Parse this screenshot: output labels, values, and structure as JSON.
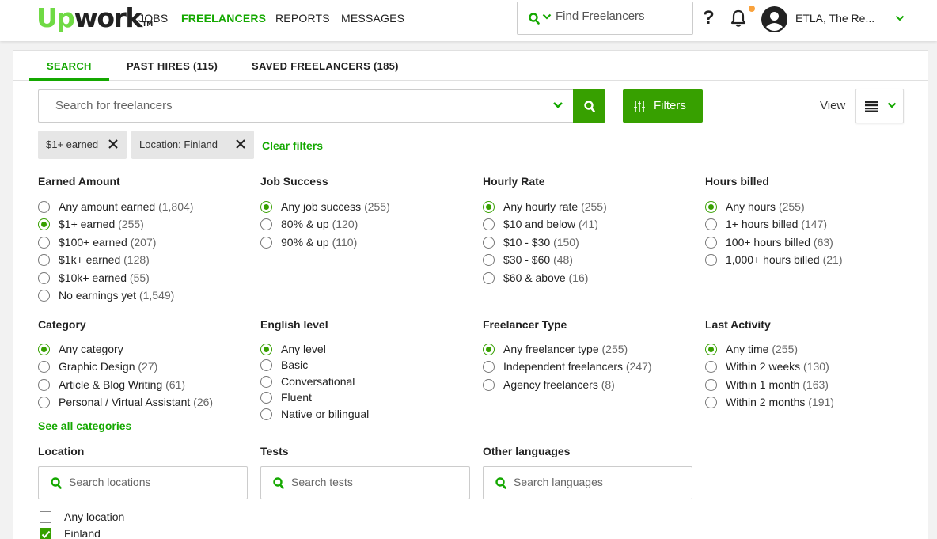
{
  "nav": {
    "logo_up": "Up",
    "logo_work": "work",
    "logo_tm": "TM",
    "links": [
      "JOBS",
      "FREELANCERS",
      "REPORTS",
      "MESSAGES"
    ],
    "active_link": "FREELANCERS",
    "search_placeholder": "Find Freelancers",
    "help": "?",
    "account_name": "ETLA, The Re..."
  },
  "tabs": [
    "SEARCH",
    "PAST HIRES (115)",
    "SAVED FREELANCERS (185)"
  ],
  "search": {
    "placeholder": "Search for freelancers",
    "filters_label": "Filters",
    "view_label": "View"
  },
  "chips": [
    "$1+ earned",
    "Location: Finland"
  ],
  "clear_filters": "Clear filters",
  "sections": {
    "earned": {
      "title": "Earned Amount",
      "options": [
        {
          "label": "Any amount earned",
          "count": "(1,804)",
          "selected": false
        },
        {
          "label": "$1+ earned",
          "count": "(255)",
          "selected": true
        },
        {
          "label": "$100+ earned",
          "count": "(207)",
          "selected": false
        },
        {
          "label": "$1k+ earned",
          "count": "(128)",
          "selected": false
        },
        {
          "label": "$10k+ earned",
          "count": "(55)",
          "selected": false
        },
        {
          "label": "No earnings yet",
          "count": "(1,549)",
          "selected": false
        }
      ]
    },
    "job_success": {
      "title": "Job Success",
      "options": [
        {
          "label": "Any job success",
          "count": "(255)",
          "selected": true
        },
        {
          "label": "80% & up",
          "count": "(120)",
          "selected": false
        },
        {
          "label": "90% & up",
          "count": "(110)",
          "selected": false
        }
      ]
    },
    "hourly_rate": {
      "title": "Hourly Rate",
      "options": [
        {
          "label": "Any hourly rate",
          "count": "(255)",
          "selected": true
        },
        {
          "label": "$10 and below",
          "count": "(41)",
          "selected": false
        },
        {
          "label": "$10 - $30",
          "count": "(150)",
          "selected": false
        },
        {
          "label": "$30 - $60",
          "count": "(48)",
          "selected": false
        },
        {
          "label": "$60 & above",
          "count": "(16)",
          "selected": false
        }
      ]
    },
    "hours_billed": {
      "title": "Hours billed",
      "options": [
        {
          "label": "Any hours",
          "count": "(255)",
          "selected": true
        },
        {
          "label": "1+ hours billed",
          "count": "(147)",
          "selected": false
        },
        {
          "label": "100+ hours billed",
          "count": "(63)",
          "selected": false
        },
        {
          "label": "1,000+ hours billed",
          "count": "(21)",
          "selected": false
        }
      ]
    },
    "category": {
      "title": "Category",
      "options": [
        {
          "label": "Any category",
          "count": "",
          "selected": true
        },
        {
          "label": "Graphic Design",
          "count": "(27)",
          "selected": false
        },
        {
          "label": "Article & Blog Writing",
          "count": "(61)",
          "selected": false
        },
        {
          "label": "Personal / Virtual Assistant",
          "count": "(26)",
          "selected": false
        }
      ],
      "see_all": "See all categories"
    },
    "english": {
      "title": "English level",
      "options": [
        {
          "label": "Any level",
          "count": "",
          "selected": true
        },
        {
          "label": "Basic",
          "count": "",
          "selected": false
        },
        {
          "label": "Conversational",
          "count": "",
          "selected": false
        },
        {
          "label": "Fluent",
          "count": "",
          "selected": false
        },
        {
          "label": "Native or bilingual",
          "count": "",
          "selected": false
        }
      ]
    },
    "freelancer_type": {
      "title": "Freelancer Type",
      "options": [
        {
          "label": "Any freelancer type",
          "count": "(255)",
          "selected": true
        },
        {
          "label": "Independent freelancers",
          "count": "(247)",
          "selected": false
        },
        {
          "label": "Agency freelancers",
          "count": "(8)",
          "selected": false
        }
      ]
    },
    "last_activity": {
      "title": "Last Activity",
      "options": [
        {
          "label": "Any time",
          "count": "(255)",
          "selected": true
        },
        {
          "label": "Within 2 weeks",
          "count": "(130)",
          "selected": false
        },
        {
          "label": "Within 1 month",
          "count": "(163)",
          "selected": false
        },
        {
          "label": "Within 2 months",
          "count": "(191)",
          "selected": false
        }
      ]
    },
    "location": {
      "title": "Location",
      "placeholder": "Search locations",
      "checks": [
        {
          "label": "Any location",
          "checked": false
        },
        {
          "label": "Finland",
          "checked": true
        }
      ]
    },
    "tests": {
      "title": "Tests",
      "placeholder": "Search tests"
    },
    "other_languages": {
      "title": "Other languages",
      "placeholder": "Search languages"
    }
  },
  "colors": {
    "brand_green": "#14a800",
    "button_green": "#37a000",
    "logo_green": "#6fda44",
    "notification_dot": "#f9a23c"
  }
}
